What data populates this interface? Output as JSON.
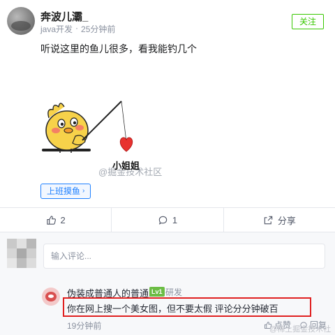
{
  "post": {
    "author": "奔波儿灞_",
    "role": "java开发",
    "separator": "·",
    "time": "25分钟前",
    "follow_label": "关注",
    "text": "听说这里的鱼儿很多，看我能钓几个",
    "image_caption": "小姐姐",
    "watermark": "@掘金技术社区",
    "topic_tag": "上班摸鱼"
  },
  "actions": {
    "likes": "2",
    "comments": "1",
    "share_label": "分享"
  },
  "comment_box": {
    "placeholder": "输入评论..."
  },
  "comment": {
    "author": "伪装成普通人的普通...",
    "level": "Lv1",
    "role": "研发",
    "text": "你在网上搜一个美女图，但不要太假 评论分分钟破百",
    "time": "19分钟前",
    "like_label": "点赞",
    "reply_label": "回复",
    "watermark": "@稀土掘金技术社区"
  },
  "colors": {
    "accent_green": "#37c700",
    "accent_blue": "#1e80ff",
    "highlight_red": "#e02020"
  }
}
